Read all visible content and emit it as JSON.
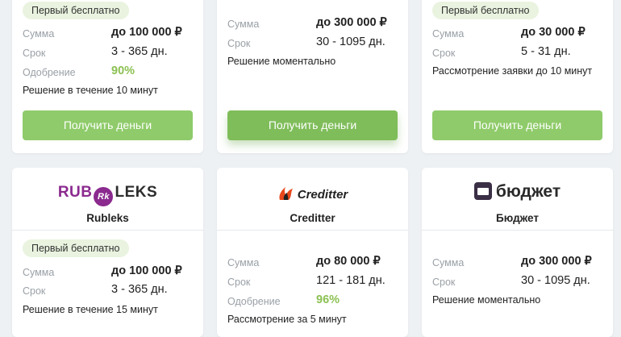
{
  "labels": {
    "sum": "Сумма",
    "term": "Срок",
    "approval": "Одобрение",
    "button": "Получить деньги"
  },
  "colors": {
    "button": "#8fcb6a",
    "button_active": "#7fbd5a",
    "approval_text": "#8cc152",
    "badge_bg": "#e9f3df"
  },
  "cards_top": [
    {
      "badge": "Первый бесплатно",
      "sum": "до 100 000 ₽",
      "term": "3 - 365 дн.",
      "approval": "90%",
      "note": "Решение в течение 10 минут"
    },
    {
      "sum": "до 300 000 ₽",
      "term": "30 - 1095 дн.",
      "note": "Решение моментально"
    },
    {
      "badge": "Первый бесплатно",
      "sum": "до 30 000 ₽",
      "term": "5 - 31 дн.",
      "note": "Рассмотрение заявки до 10 минут"
    }
  ],
  "cards_bottom": [
    {
      "logo_left": "RUB",
      "logo_mark": "Rk",
      "logo_right": "LEKS",
      "name": "Rubleks",
      "badge": "Первый бесплатно",
      "sum": "до 100 000 ₽",
      "term": "3 - 365 дн.",
      "note": "Решение в течение 15 минут"
    },
    {
      "logo_text": "Creditter",
      "name": "Creditter",
      "sum": "до 80 000 ₽",
      "term": "121 - 181 дн.",
      "approval": "96%",
      "note": "Рассмотрение за 5 минут"
    },
    {
      "logo_text": "бюджет",
      "name": "Бюджет",
      "sum": "до 300 000 ₽",
      "term": "30 - 1095 дн.",
      "note": "Решение моментально"
    }
  ]
}
